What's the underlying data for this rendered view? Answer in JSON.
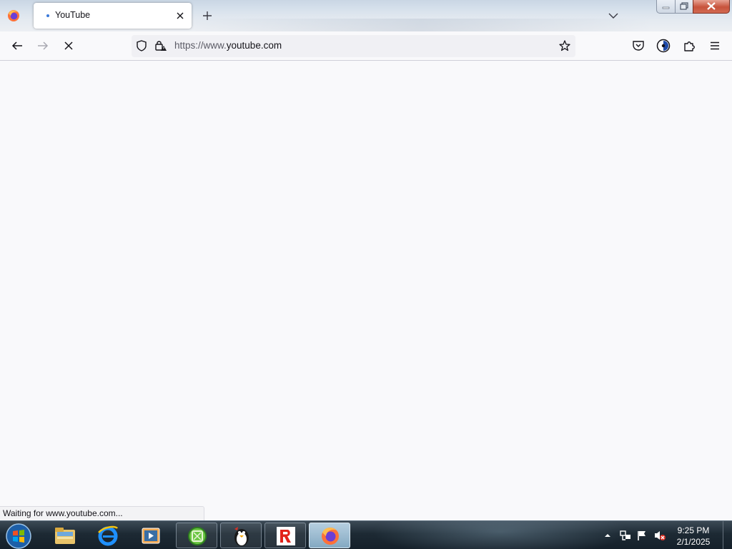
{
  "browser": {
    "tab": {
      "title": "YouTube"
    },
    "address_bar": {
      "url_prefix": "https://www.",
      "url_domain": "youtube.com"
    },
    "status_text": "Waiting for www.youtube.com..."
  },
  "taskbar": {
    "clock": {
      "time": "9:25 PM",
      "date": "2/1/2025"
    },
    "apps": [
      "windows-explorer",
      "internet-explorer",
      "media-player",
      "xbox",
      "tux-paint",
      "roblox",
      "firefox"
    ],
    "active_app": "firefox"
  },
  "colors": {
    "accent": "#3b7ad9",
    "page_bg": "#f9f9fb",
    "taskbar": "#1d2a34"
  }
}
